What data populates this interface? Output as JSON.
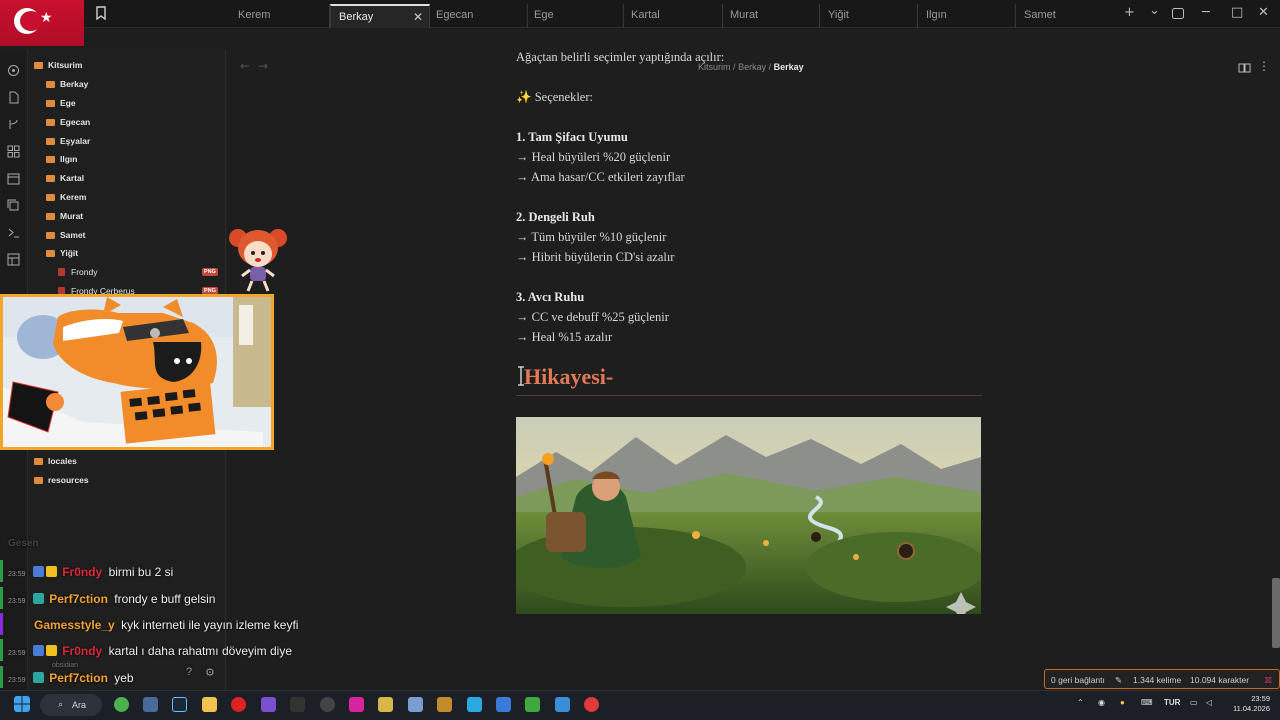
{
  "tabs": [
    "Kerem",
    "Berkay",
    "Egecan",
    "Ege",
    "Kartal",
    "Murat",
    "Yiğit",
    "Ilgın",
    "Samet"
  ],
  "active_tab_close": "✕",
  "window_controls": {
    "new_tab": "+",
    "chevron": "⌄",
    "minimize": "─",
    "maximize": "□",
    "close": "✕"
  },
  "breadcrumb": {
    "root": "Kitsurim",
    "sep1": "/",
    "parent": "Berkay",
    "sep2": "/",
    "current": "Berkay"
  },
  "sidebar": {
    "root": "Kitsurim",
    "folders": [
      "Berkay",
      "Ege",
      "Egecan",
      "Eşyalar",
      "Ilgın",
      "Kartal",
      "Kerem",
      "Murat",
      "Samet",
      "Yiğit"
    ],
    "files": [
      {
        "name": "Frondy",
        "badge": "PNG"
      },
      {
        "name": "Frondy Cerberus",
        "badge": "PNG"
      }
    ],
    "lower_folders": [
      "locales",
      "resources"
    ]
  },
  "chat": {
    "header_fragment": "Gesen",
    "messages": [
      {
        "time": "23:59",
        "nick": "Fr0ndy",
        "nick_color": "#e0283a",
        "text": "birmi bu 2 si",
        "badges": [
          "#4b7bd8",
          "#f0c020"
        ]
      },
      {
        "time": "23:59",
        "nick": "Perf7ction",
        "nick_color": "#f0a232",
        "text": "frondy e buff gelsin",
        "badges": [
          "#2aa8a0"
        ]
      },
      {
        "time": "",
        "nick": "Gamesstyle_y",
        "nick_color": "#f0a232",
        "text": "kyk interneti ile yayın izleme keyfi",
        "badges": []
      },
      {
        "time": "23:59",
        "nick": "Fr0ndy",
        "nick_color": "#e0283a",
        "text": "kartal ı daha rahatmı döveyim diye",
        "badges": [
          "#4b7bd8",
          "#f0c020"
        ]
      },
      {
        "time": "23:59",
        "nick": "Perf7ction",
        "nick_color": "#f0a232",
        "text": "yeb",
        "badges": [
          "#2aa8a0"
        ]
      }
    ],
    "overlay_label": "obsidian",
    "help_symbol": "?",
    "settings_symbol": "⚙"
  },
  "content": {
    "intro": "Ağaçtan belirli seçimler yaptığında açılır:",
    "options_heading": "✨ Seçenekler:",
    "sections": [
      {
        "title": "1. Tam Şifacı Uyumu",
        "lines": [
          "→ Heal büyüleri %20 güçlenir",
          "→ Ama hasar/CC etkileri zayıflar"
        ]
      },
      {
        "title": "2. Dengeli Ruh",
        "lines": [
          "→ Tüm büyüler %10 güçlenir",
          "→ Hibrit büyülerin CD'si azalır"
        ]
      },
      {
        "title": "3. Avcı Ruhu",
        "lines": [
          "→ CC ve debuff %25 güçlenir",
          "→ Heal %15 azalır"
        ]
      }
    ],
    "story_heading": "Hikayesi-"
  },
  "status": {
    "backlinks": "0 geri bağlantı",
    "words": "1.344 kelime",
    "chars": "10.094 karakter"
  },
  "taskbar": {
    "search_label": "Ara",
    "lang": "TUR",
    "time": "23:59",
    "date": "11.04.2026"
  },
  "colors": {
    "accent": "#e27a58",
    "folder": "#e08a3c",
    "status_border": "#c8691e"
  }
}
